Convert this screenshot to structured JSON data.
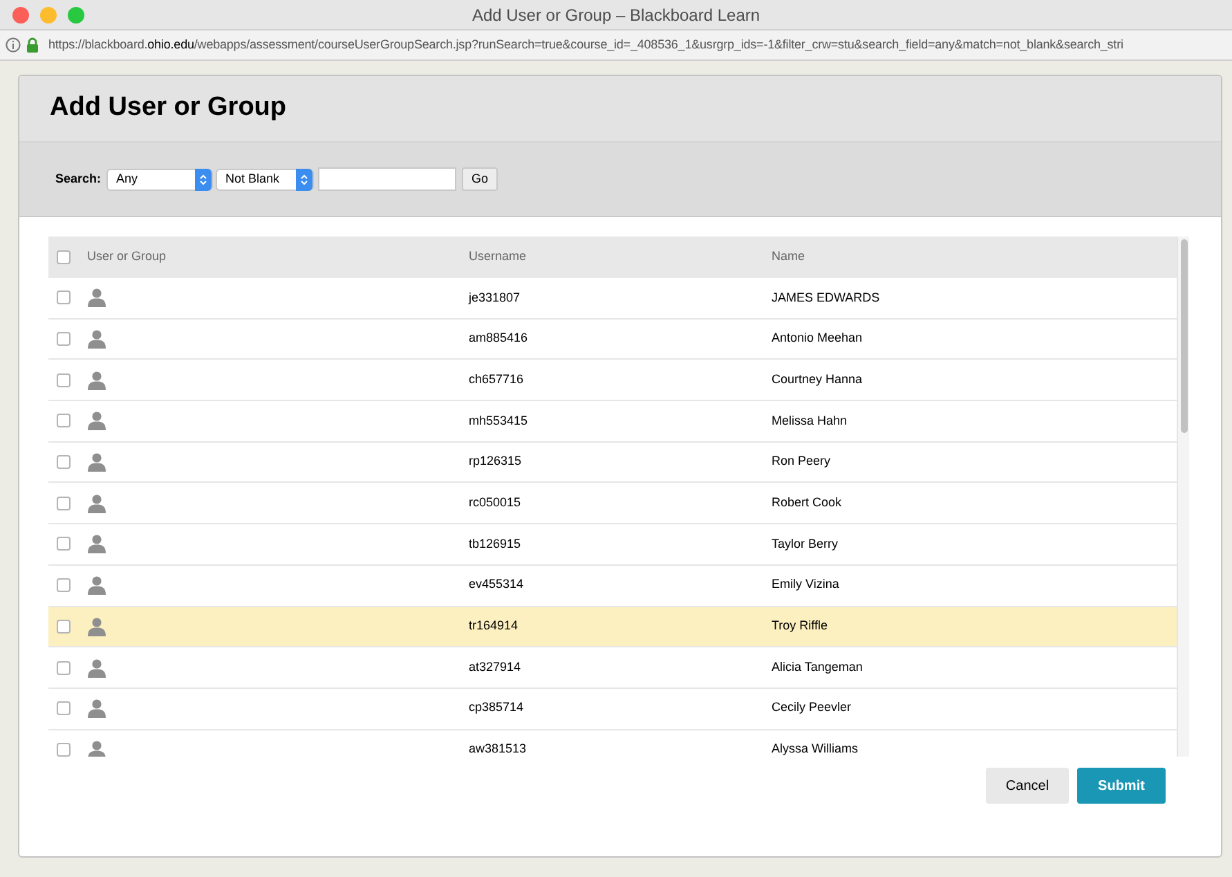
{
  "window": {
    "title": "Add User or Group – Blackboard Learn"
  },
  "address_bar": {
    "url_before": "https://blackboard.",
    "url_domain": "ohio.edu",
    "url_after": "/webapps/assessment/courseUserGroupSearch.jsp?runSearch=true&course_id=_408536_1&usrgrp_ids=-1&filter_crw=stu&search_field=any&match=not_blank&search_stri"
  },
  "dialog": {
    "title": "Add User or Group"
  },
  "search": {
    "label": "Search:",
    "field": "Any",
    "match": "Not Blank",
    "go": "Go"
  },
  "table": {
    "select_all_checked": false,
    "columns": [
      "User or Group",
      "Username",
      "Name"
    ],
    "rows": [
      {
        "username": "je331807",
        "name": "JAMES EDWARDS",
        "checked": false,
        "highlighted": false
      },
      {
        "username": "am885416",
        "name": "Antonio Meehan",
        "checked": false,
        "highlighted": false
      },
      {
        "username": "ch657716",
        "name": "Courtney Hanna",
        "checked": false,
        "highlighted": false
      },
      {
        "username": "mh553415",
        "name": "Melissa Hahn",
        "checked": false,
        "highlighted": false
      },
      {
        "username": "rp126315",
        "name": "Ron Peery",
        "checked": false,
        "highlighted": false
      },
      {
        "username": "rc050015",
        "name": "Robert Cook",
        "checked": false,
        "highlighted": false
      },
      {
        "username": "tb126915",
        "name": "Taylor Berry",
        "checked": false,
        "highlighted": false
      },
      {
        "username": "ev455314",
        "name": "Emily Vizina",
        "checked": false,
        "highlighted": false
      },
      {
        "username": "tr164914",
        "name": "Troy Riffle",
        "checked": false,
        "highlighted": true
      },
      {
        "username": "at327914",
        "name": "Alicia Tangeman",
        "checked": false,
        "highlighted": false
      },
      {
        "username": "cp385714",
        "name": "Cecily Peevler",
        "checked": false,
        "highlighted": false
      },
      {
        "username": "aw381513",
        "name": "Alyssa Williams",
        "checked": false,
        "highlighted": false
      }
    ]
  },
  "buttons": {
    "cancel": "Cancel",
    "submit": "Submit"
  }
}
